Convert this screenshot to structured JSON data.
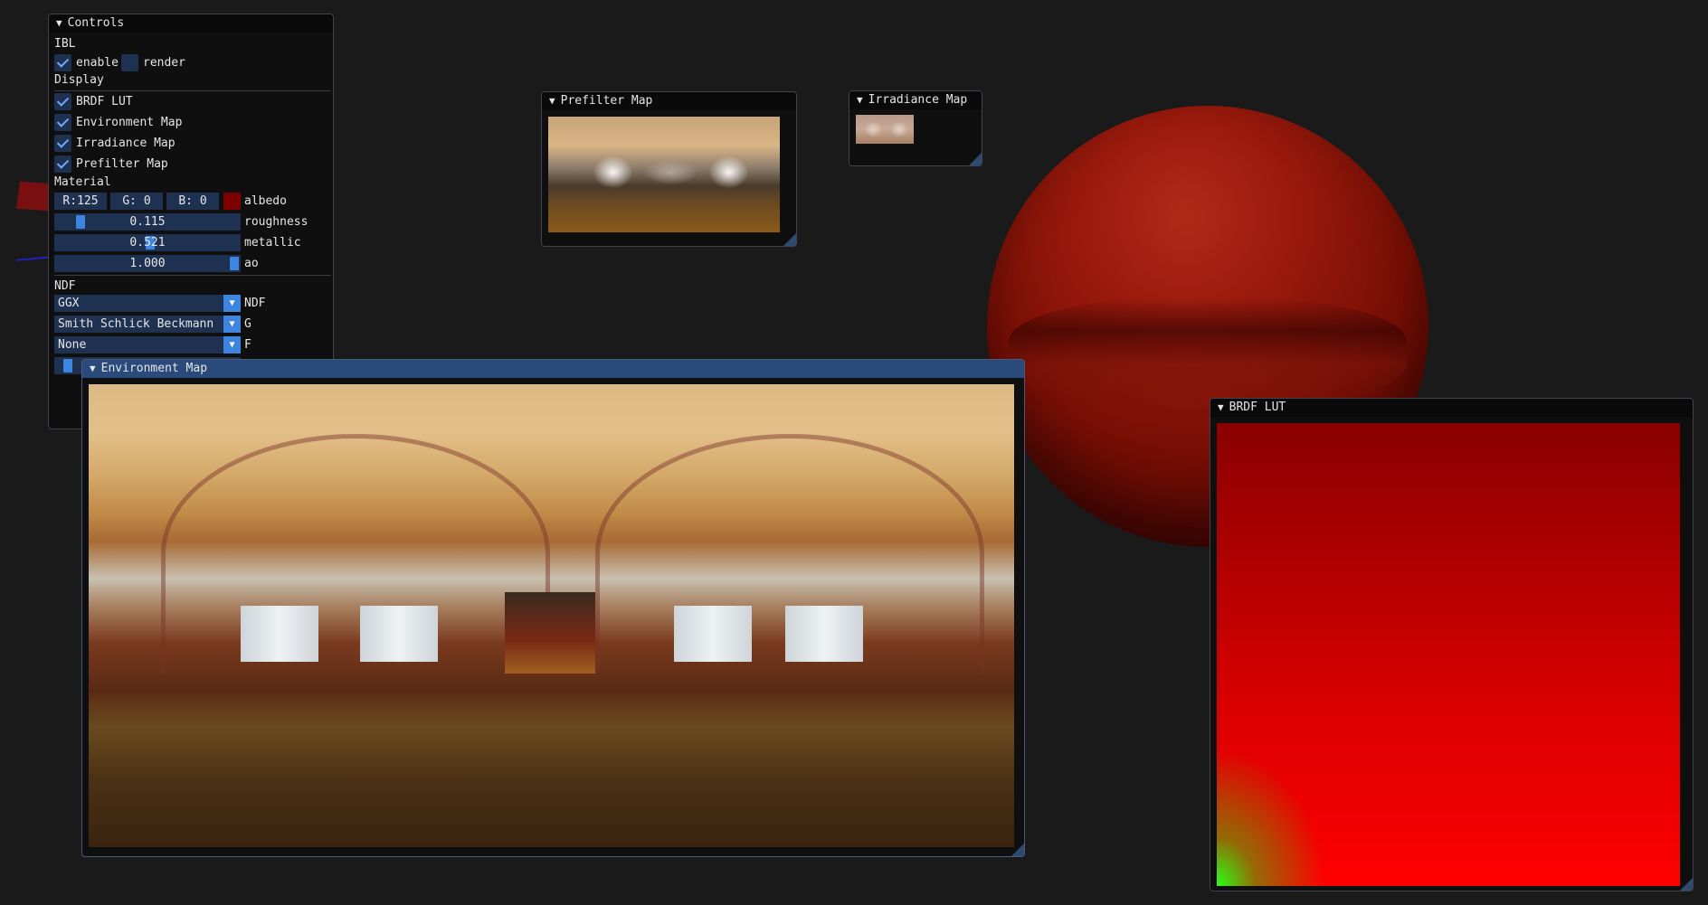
{
  "colors": {
    "background": "#1a1a1a",
    "accent": "#3d85e0",
    "field": "#1e3150",
    "title_active": "#294a7a",
    "albedo": "#7d0000"
  },
  "controls": {
    "title": "Controls",
    "ibl_header": "IBL",
    "enable_label": "enable",
    "enable_checked": true,
    "render_label": "render",
    "render_checked": false,
    "display_header": "Display",
    "display_items": [
      {
        "label": "BRDF LUT",
        "checked": true
      },
      {
        "label": "Environment Map",
        "checked": true
      },
      {
        "label": "Irradiance Map",
        "checked": true
      },
      {
        "label": "Prefilter Map",
        "checked": true
      }
    ],
    "material_header": "Material",
    "albedo": {
      "r": "R:125",
      "g": "G:  0",
      "b": "B:  0",
      "label": "albedo"
    },
    "roughness": {
      "value": "0.115",
      "level": 0.115,
      "label": "roughness"
    },
    "metallic": {
      "value": "0.521",
      "level": 0.521,
      "label": "metallic"
    },
    "ao": {
      "value": "1.000",
      "level": 1.0,
      "label": "ao"
    },
    "ndf_header": "NDF",
    "ndf_select": {
      "value": "GGX",
      "label": "NDF"
    },
    "g_select": {
      "value": "Smith Schlick Beckmann",
      "label": "G"
    },
    "f_select": {
      "value": "None",
      "label": "F"
    }
  },
  "prefilter": {
    "title": "Prefilter Map"
  },
  "irradiance": {
    "title": "Irradiance Map"
  },
  "environment": {
    "title": "Environment Map"
  },
  "brdf": {
    "title": "BRDF LUT"
  },
  "icons": {
    "collapse": "triangle-down-icon",
    "check": "checkmark-icon",
    "dropdown": "chevron-down-icon"
  }
}
